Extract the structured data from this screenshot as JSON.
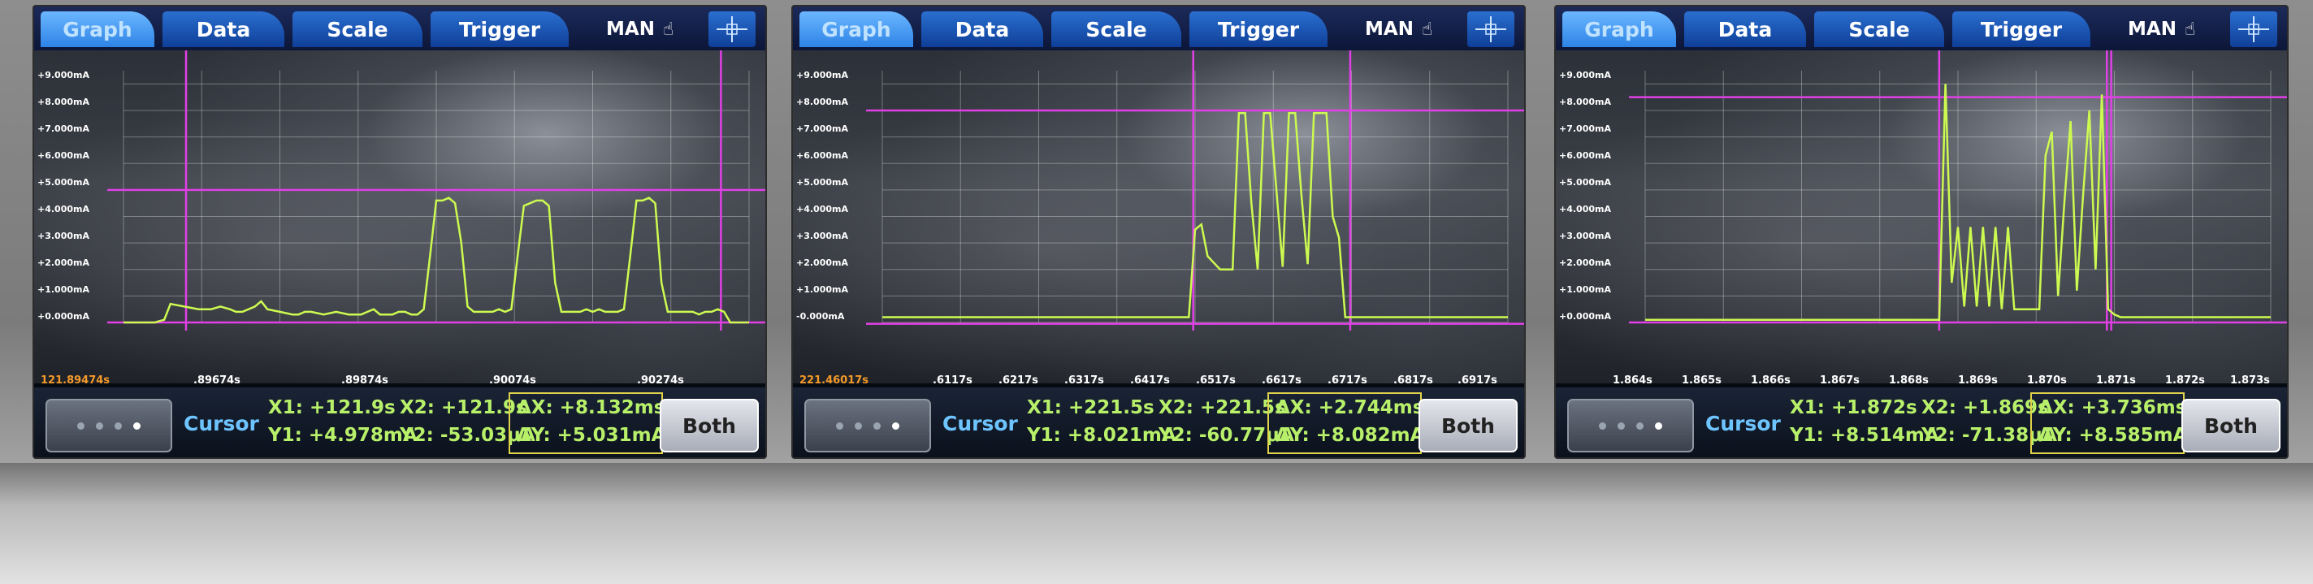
{
  "screens": [
    {
      "tabs": {
        "graph": "Graph",
        "data": "Data",
        "scale": "Scale",
        "trigger": "Trigger"
      },
      "mode": "MAN",
      "y_ticks": [
        "+9.000mA",
        "+8.000mA",
        "+7.000mA",
        "+6.000mA",
        "+5.000mA",
        "+4.000mA",
        "+3.000mA",
        "+2.000mA",
        "+1.000mA",
        "+0.000mA"
      ],
      "x_ticks": [
        "121.89474s",
        ".89674s",
        ".89874s",
        ".90074s",
        ".90274s"
      ],
      "cursor_label": "Cursor",
      "x1": "X1: +121.9s",
      "y1": "Y1: +4.978mA",
      "x2": "X2: +121.9s",
      "y2": "Y2: -53.03μA",
      "dx": "ΔX: +8.132ms",
      "dy": "ΔY: +5.031mA",
      "both": "Both"
    },
    {
      "tabs": {
        "graph": "Graph",
        "data": "Data",
        "scale": "Scale",
        "trigger": "Trigger"
      },
      "mode": "MAN",
      "y_ticks": [
        "+9.000mA",
        "+8.000mA",
        "+7.000mA",
        "+6.000mA",
        "+5.000mA",
        "+4.000mA",
        "+3.000mA",
        "+2.000mA",
        "+1.000mA",
        "-0.000mA"
      ],
      "x_ticks": [
        "221.46017s",
        ".6117s",
        ".6217s",
        ".6317s",
        ".6417s",
        ".6517s",
        ".6617s",
        ".6717s",
        ".6817s",
        ".6917s"
      ],
      "cursor_label": "Cursor",
      "x1": "X1: +221.5s",
      "y1": "Y1: +8.021mA",
      "x2": "X2: +221.5s",
      "y2": "Y2: -60.77μA",
      "dx": "ΔX: +2.744ms",
      "dy": "ΔY: +8.082mA",
      "both": "Both"
    },
    {
      "tabs": {
        "graph": "Graph",
        "data": "Data",
        "scale": "Scale",
        "trigger": "Trigger"
      },
      "mode": "MAN",
      "y_ticks": [
        "+9.000mA",
        "+8.000mA",
        "+7.000mA",
        "+6.000mA",
        "+5.000mA",
        "+4.000mA",
        "+3.000mA",
        "+2.000mA",
        "+1.000mA",
        "+0.000mA"
      ],
      "x_ticks": [
        "1.864s",
        "1.865s",
        "1.866s",
        "1.867s",
        "1.868s",
        "1.869s",
        "1.870s",
        "1.871s",
        "1.872s",
        "1.873s"
      ],
      "cursor_label": "Cursor",
      "x1": "X1: +1.872s",
      "y1": "Y1: +8.514mA",
      "x2": "X2: +1.869s",
      "y2": "Y2: -71.38μA",
      "dx": "ΔX: +3.736ms",
      "dy": "ΔY: +8.585mA",
      "both": "Both"
    }
  ],
  "chart_data": [
    {
      "type": "line",
      "ylim": [
        0,
        9.5
      ],
      "series": [
        {
          "x": [
            0.0,
            0.05,
            0.065,
            0.075,
            0.12,
            0.14,
            0.155,
            0.17,
            0.18,
            0.19,
            0.2,
            0.21,
            0.22,
            0.23,
            0.25,
            0.27,
            0.28,
            0.29,
            0.3,
            0.32,
            0.34,
            0.36,
            0.37,
            0.38,
            0.39,
            0.4,
            0.41,
            0.42,
            0.43,
            0.44,
            0.45,
            0.46,
            0.47,
            0.48,
            0.49,
            0.5,
            0.51,
            0.52,
            0.53,
            0.54,
            0.55,
            0.56,
            0.57,
            0.58,
            0.59,
            0.6,
            0.61,
            0.62,
            0.63,
            0.64,
            0.65,
            0.66,
            0.67,
            0.68,
            0.69,
            0.7,
            0.71,
            0.72,
            0.73,
            0.74,
            0.75,
            0.76,
            0.77,
            0.78,
            0.79,
            0.8,
            0.81,
            0.82,
            0.83,
            0.84,
            0.85,
            0.86,
            0.87,
            0.88,
            0.89,
            0.9,
            0.91,
            0.92,
            0.93,
            0.94,
            0.95,
            0.96,
            0.97,
            0.98,
            0.99,
            1.0
          ],
          "y": [
            0.0,
            0.0,
            0.1,
            0.7,
            0.5,
            0.5,
            0.6,
            0.5,
            0.4,
            0.4,
            0.5,
            0.6,
            0.8,
            0.5,
            0.4,
            0.3,
            0.3,
            0.4,
            0.4,
            0.3,
            0.4,
            0.3,
            0.3,
            0.3,
            0.4,
            0.5,
            0.3,
            0.3,
            0.3,
            0.4,
            0.4,
            0.3,
            0.3,
            0.5,
            2.5,
            4.6,
            4.6,
            4.7,
            4.5,
            3.0,
            0.6,
            0.4,
            0.4,
            0.4,
            0.4,
            0.5,
            0.4,
            0.5,
            2.5,
            4.4,
            4.5,
            4.6,
            4.6,
            4.4,
            1.5,
            0.4,
            0.4,
            0.4,
            0.4,
            0.5,
            0.4,
            0.5,
            0.4,
            0.4,
            0.4,
            0.5,
            2.5,
            4.6,
            4.6,
            4.7,
            4.5,
            1.5,
            0.4,
            0.4,
            0.4,
            0.4,
            0.4,
            0.3,
            0.4,
            0.4,
            0.5,
            0.4,
            0.0,
            0.0,
            0.0,
            0.0
          ]
        }
      ],
      "cursors": {
        "y_levels": [
          5.0,
          0.0
        ],
        "x_positions": [
          0.1,
          0.955
        ]
      }
    },
    {
      "type": "line",
      "ylim": [
        0,
        9.5
      ],
      "series": [
        {
          "x": [
            0.0,
            0.05,
            0.1,
            0.15,
            0.2,
            0.25,
            0.3,
            0.35,
            0.4,
            0.45,
            0.49,
            0.5,
            0.51,
            0.52,
            0.54,
            0.56,
            0.57,
            0.58,
            0.59,
            0.6,
            0.61,
            0.62,
            0.63,
            0.64,
            0.65,
            0.66,
            0.67,
            0.68,
            0.69,
            0.7,
            0.71,
            0.72,
            0.73,
            0.74,
            0.75,
            0.76,
            0.77,
            0.78,
            0.79,
            0.8,
            1.0
          ],
          "y": [
            0.2,
            0.2,
            0.2,
            0.2,
            0.2,
            0.2,
            0.2,
            0.2,
            0.2,
            0.2,
            0.2,
            3.5,
            3.7,
            2.5,
            2.0,
            2.0,
            7.9,
            7.9,
            4.5,
            2.0,
            7.9,
            7.9,
            5.0,
            2.1,
            7.9,
            7.9,
            4.8,
            2.2,
            7.9,
            7.9,
            7.9,
            4.0,
            3.2,
            0.2,
            0.2,
            0.2,
            0.2,
            0.2,
            0.2,
            0.2,
            0.2
          ]
        }
      ],
      "cursors": {
        "y_levels": [
          8.0,
          -0.05
        ],
        "x_positions": [
          0.497,
          0.748
        ]
      }
    },
    {
      "type": "line",
      "ylim": [
        0,
        9.5
      ],
      "series": [
        {
          "x": [
            0.0,
            0.05,
            0.1,
            0.2,
            0.3,
            0.4,
            0.45,
            0.47,
            0.48,
            0.49,
            0.5,
            0.51,
            0.52,
            0.53,
            0.54,
            0.55,
            0.56,
            0.57,
            0.58,
            0.59,
            0.6,
            0.61,
            0.62,
            0.63,
            0.64,
            0.65,
            0.66,
            0.67,
            0.68,
            0.69,
            0.7,
            0.71,
            0.72,
            0.73,
            0.74,
            0.75,
            0.76,
            0.77,
            0.78,
            0.79,
            0.8,
            0.85,
            0.9,
            1.0
          ],
          "y": [
            0.1,
            0.1,
            0.1,
            0.1,
            0.1,
            0.1,
            0.1,
            0.1,
            9.0,
            1.5,
            3.6,
            0.6,
            3.6,
            0.6,
            3.6,
            0.6,
            3.6,
            0.5,
            3.6,
            0.5,
            0.5,
            0.5,
            0.5,
            0.5,
            6.3,
            7.2,
            1.0,
            4.5,
            7.6,
            1.2,
            4.8,
            8.0,
            2.0,
            8.6,
            0.5,
            0.3,
            0.2,
            0.2,
            0.2,
            0.2,
            0.2,
            0.2,
            0.2,
            0.2
          ]
        }
      ],
      "cursors": {
        "y_levels": [
          8.5,
          0.0
        ],
        "x_positions": [
          0.47,
          0.745,
          0.738
        ]
      }
    }
  ]
}
